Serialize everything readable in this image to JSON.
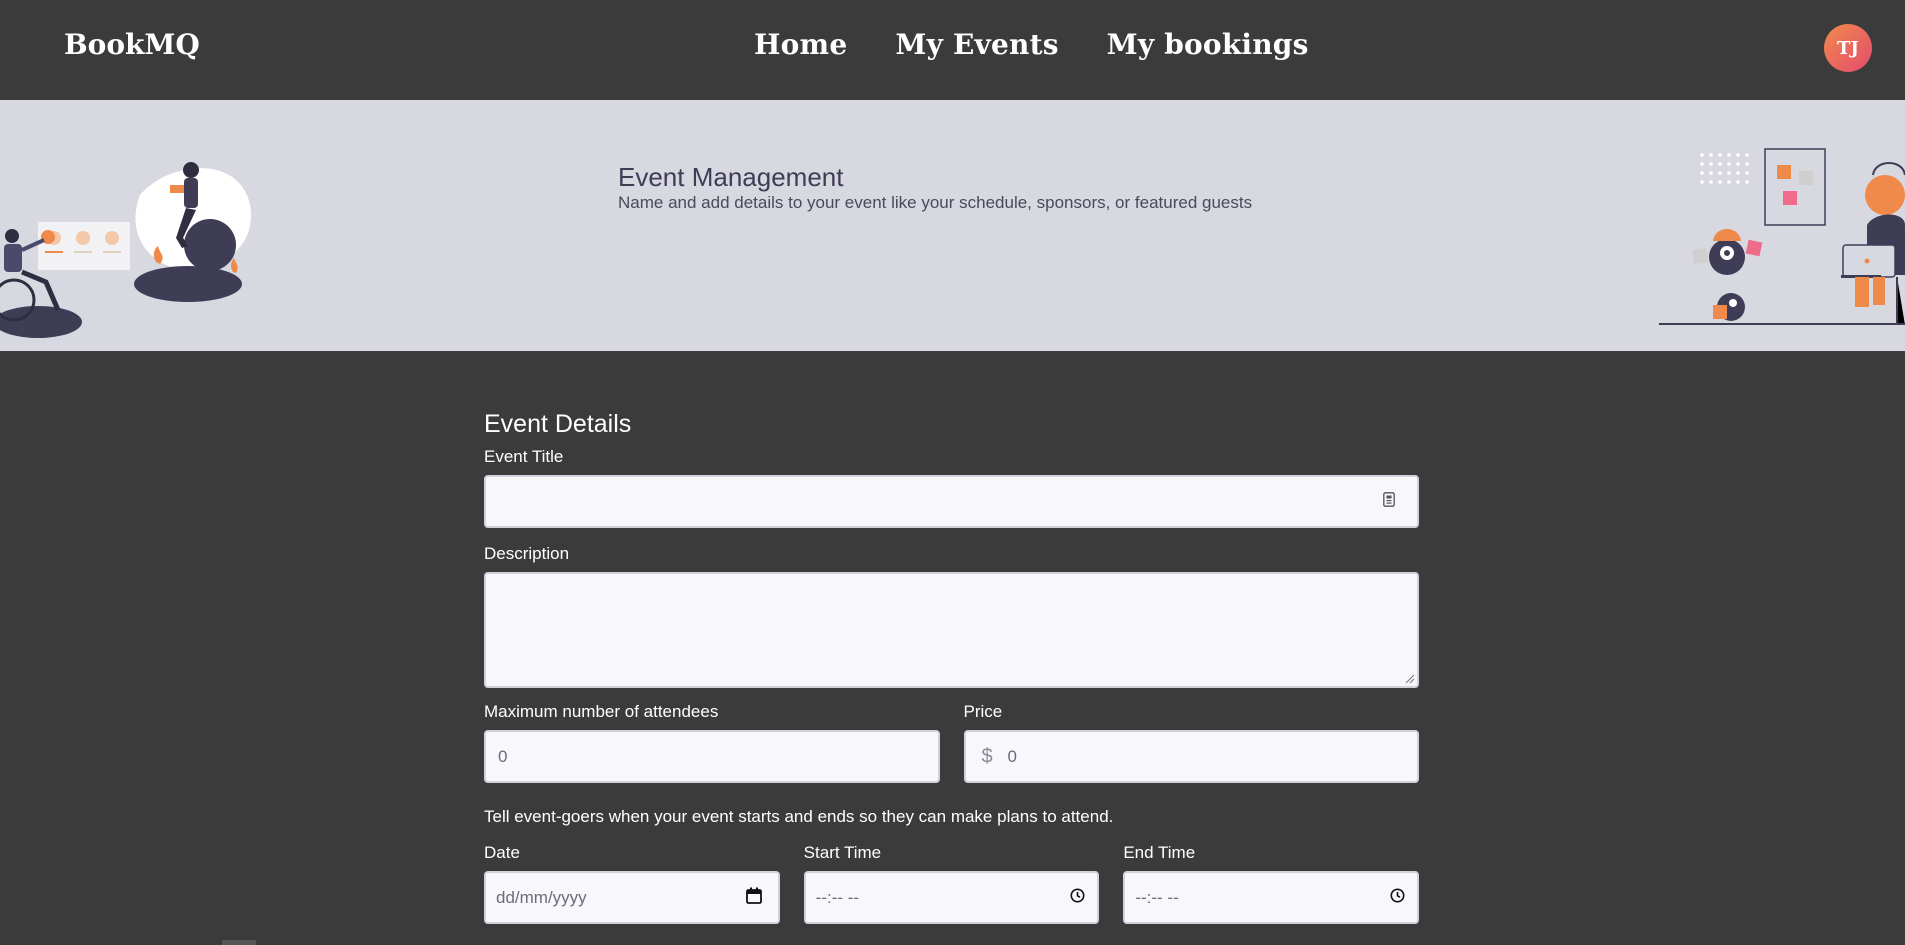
{
  "nav": {
    "brand": "BookMQ",
    "links": [
      "Home",
      "My Events",
      "My bookings"
    ],
    "avatar_initials": "TJ"
  },
  "hero": {
    "title": "Event Management",
    "subtitle": "Name and add details to your event like your schedule, sponsors, or featured guests"
  },
  "form": {
    "section_title": "Event Details",
    "event_title_label": "Event Title",
    "event_title_value": "",
    "description_label": "Description",
    "description_value": "",
    "max_attendees_label": "Maximum number of attendees",
    "max_attendees_value": "0",
    "price_label": "Price",
    "price_currency": "$",
    "price_value": "0",
    "schedule_info": "Tell event-goers when your event starts and ends so they can make plans to attend.",
    "date_label": "Date",
    "date_placeholder": "dd/mm/yyyy",
    "start_time_label": "Start Time",
    "start_time_placeholder": "--:-- --",
    "end_time_label": "End Time",
    "end_time_placeholder": "--:-- --"
  },
  "icons": {
    "title_field_icon": "id-card-icon",
    "date_icon": "calendar-icon",
    "time_icon": "clock-icon"
  },
  "colors": {
    "background": "#3b3b3b",
    "hero_background": "#d8d8e1",
    "input_background": "#f7f7fc",
    "accent_orange": "#f08a4b",
    "accent_pink": "#e44b6e",
    "illustration_dark": "#3f3d56"
  }
}
